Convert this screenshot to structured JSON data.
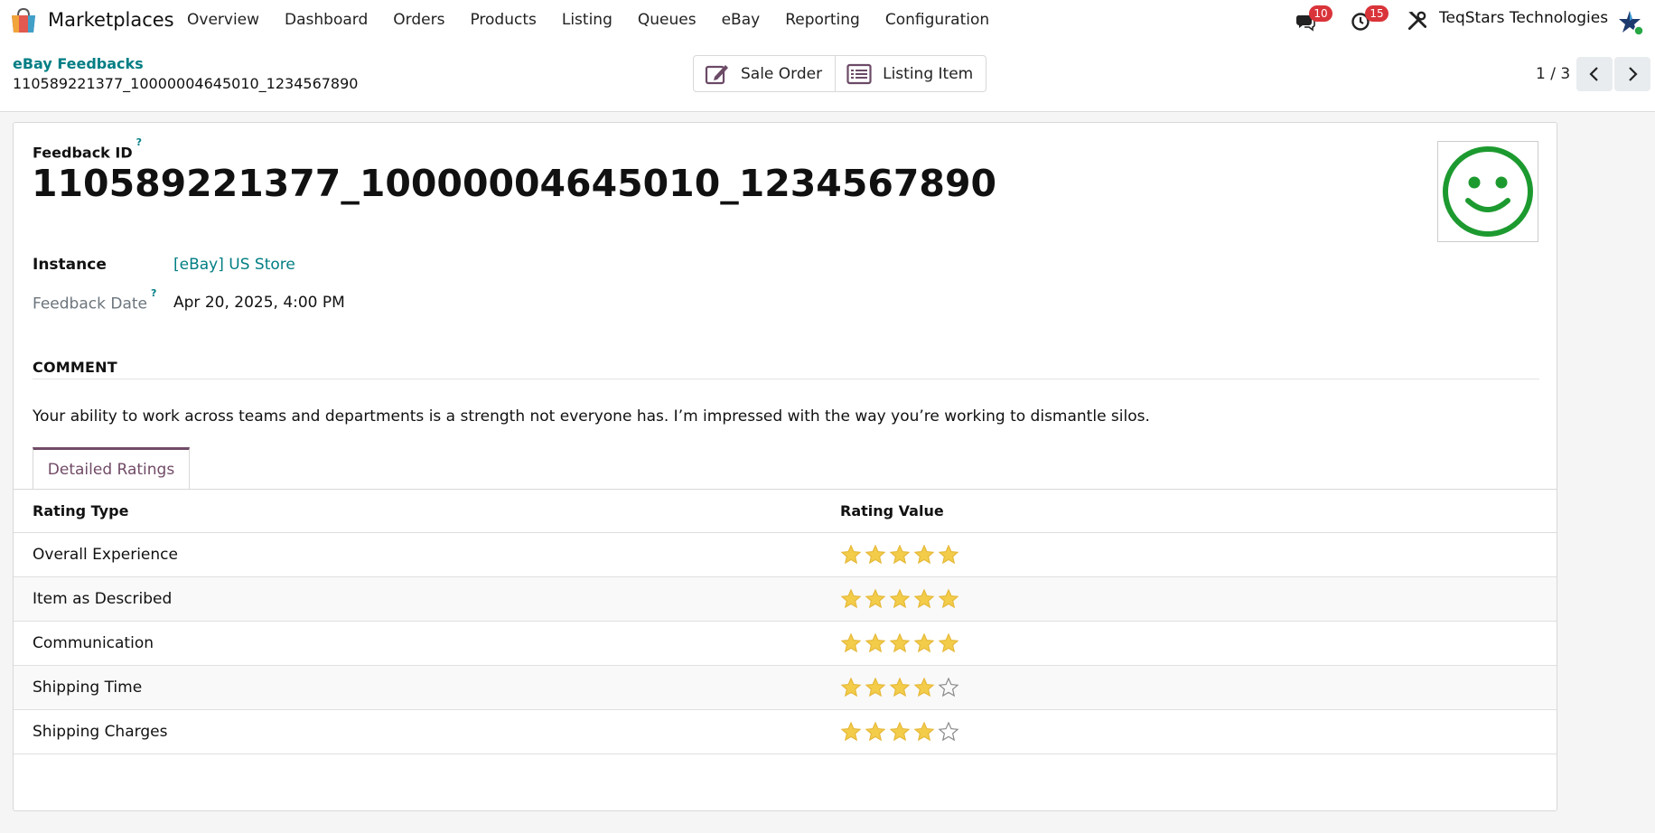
{
  "app": {
    "name": "Marketplaces"
  },
  "menu": [
    "Overview",
    "Dashboard",
    "Orders",
    "Products",
    "Listing",
    "Queues",
    "eBay",
    "Reporting",
    "Configuration"
  ],
  "systray": {
    "messages_count": "10",
    "activities_count": "15",
    "company": "TeqStars Technologies"
  },
  "breadcrumb": {
    "parent": "eBay Feedbacks",
    "current": "110589221377_10000004645010_1234567890"
  },
  "smart_buttons": {
    "sale_order": "Sale Order",
    "listing_item": "Listing Item"
  },
  "pager": {
    "value": "1 / 3"
  },
  "form": {
    "feedback_id_label": "Feedback ID",
    "help_mark": "?",
    "feedback_id": "110589221377_10000004645010_1234567890",
    "instance_label": "Instance",
    "instance_value": "[eBay] US Store",
    "feedback_date_label": "Feedback Date",
    "feedback_date_value": "Apr 20, 2025, 4:00 PM",
    "comment_title": "COMMENT",
    "comment_text": "Your ability to work across teams and departments is a strength not everyone has. I’m impressed with the way you’re working to dismantle silos."
  },
  "tabs": {
    "detailed_ratings": "Detailed Ratings"
  },
  "ratings": {
    "headers": {
      "type": "Rating Type",
      "value": "Rating Value"
    },
    "max": 5,
    "rows": [
      {
        "type": "Overall Experience",
        "value": 5
      },
      {
        "type": "Item as Described",
        "value": 5
      },
      {
        "type": "Communication",
        "value": 5
      },
      {
        "type": "Shipping Time",
        "value": 4
      },
      {
        "type": "Shipping Charges",
        "value": 4
      }
    ]
  },
  "colors": {
    "accent": "#714b67",
    "link": "#017e84",
    "star": "#f3cc4a",
    "smiley": "#1d9a2f",
    "badge": "#d9343a"
  }
}
